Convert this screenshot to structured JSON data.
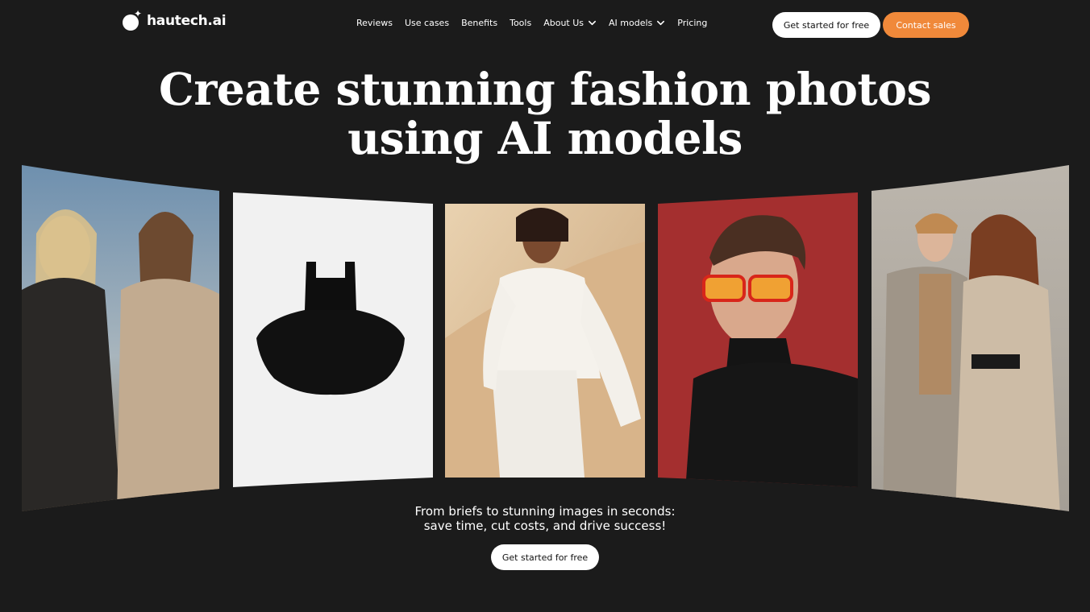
{
  "brand": {
    "name": "hautech.ai"
  },
  "nav": {
    "items": [
      {
        "label": "Reviews",
        "dropdown": false
      },
      {
        "label": "Use cases",
        "dropdown": false
      },
      {
        "label": "Benefits",
        "dropdown": false
      },
      {
        "label": "Tools",
        "dropdown": false
      },
      {
        "label": "About Us",
        "dropdown": true
      },
      {
        "label": "AI models",
        "dropdown": true
      },
      {
        "label": "Pricing",
        "dropdown": false
      }
    ],
    "get_started_label": "Get started for free",
    "contact_label": "Contact sales"
  },
  "hero": {
    "title_line1": "Create stunning fashion photos",
    "title_line2": "using AI models",
    "subtitle_line1": "From briefs to stunning images in seconds:",
    "subtitle_line2": "save time, cut costs, and drive success!",
    "cta_label": "Get started for free"
  },
  "gallery": {
    "images": [
      "two-women-in-suits-photo",
      "black-tutu-dress-photo",
      "woman-in-white-outfit-photo",
      "man-with-red-glasses-photo",
      "couple-in-beige-suits-photo"
    ]
  },
  "colors": {
    "background": "#1b1b1b",
    "accent": "#f0893a",
    "button_light": "#ffffff"
  }
}
